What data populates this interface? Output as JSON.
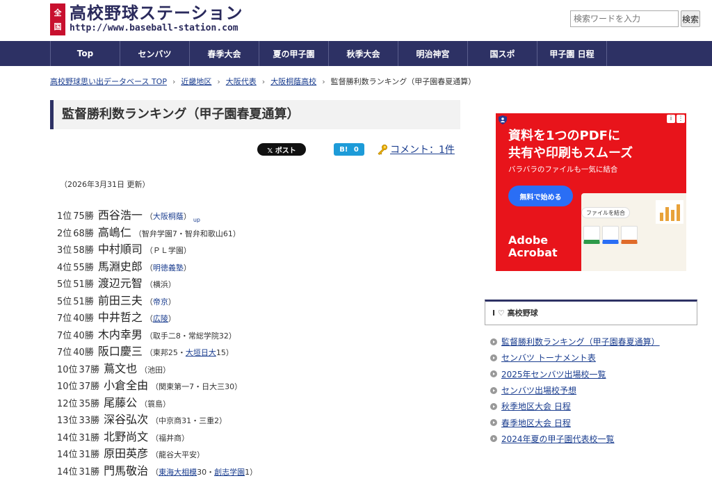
{
  "header": {
    "badge": [
      "全",
      "国"
    ],
    "site_title": "高校野球ステーション",
    "site_url": "http://www.baseball-station.com",
    "search_placeholder": "検索ワードを入力",
    "search_button": "検索"
  },
  "nav": {
    "items": [
      "Top",
      "センバツ",
      "春季大会",
      "夏の甲子園",
      "秋季大会",
      "明治神宮",
      "国スポ",
      "甲子園 日程"
    ]
  },
  "breadcrumb": [
    "高校野球思い出データベース TOP",
    "近畿地区",
    "大阪代表",
    "大阪桐蔭高校",
    "監督勝利数ランキング（甲子園春夏通算）"
  ],
  "main": {
    "title": "監督勝利数ランキング（甲子園春夏通算）",
    "share": {
      "x_label": "𝕏 ポスト",
      "hatena_label": "B!",
      "hatena_count": "0",
      "comment_label": "コメント：1件"
    },
    "updated": "（2026年3月31日 更新）",
    "ranking": [
      {
        "pos": "1位",
        "wins": "75勝",
        "name": "西谷浩一",
        "school": [
          {
            "t": "（"
          },
          {
            "t": "大阪桐蔭",
            "link": true
          },
          {
            "t": "）"
          }
        ],
        "up": "up"
      },
      {
        "pos": "2位",
        "wins": "68勝",
        "name": "高嶋仁",
        "school": [
          {
            "t": "（智弁学園7・智弁和歌山61）"
          }
        ]
      },
      {
        "pos": "3位",
        "wins": "58勝",
        "name": "中村順司",
        "school": [
          {
            "t": "（ＰＬ学園）"
          }
        ]
      },
      {
        "pos": "4位",
        "wins": "55勝",
        "name": "馬淵史郎",
        "school": [
          {
            "t": "（"
          },
          {
            "t": "明徳義塾",
            "link": true
          },
          {
            "t": "）"
          }
        ]
      },
      {
        "pos": "5位",
        "wins": "51勝",
        "name": "渡辺元智",
        "school": [
          {
            "t": "（横浜）"
          }
        ]
      },
      {
        "pos": "5位",
        "wins": "51勝",
        "name": "前田三夫",
        "school": [
          {
            "t": "（"
          },
          {
            "t": "帝京",
            "link": true
          },
          {
            "t": "）"
          }
        ]
      },
      {
        "pos": "7位",
        "wins": "40勝",
        "name": "中井哲之",
        "school": [
          {
            "t": "（"
          },
          {
            "t": "広陵",
            "link": true,
            "u": true
          },
          {
            "t": "）"
          }
        ]
      },
      {
        "pos": "7位",
        "wins": "40勝",
        "name": "木内幸男",
        "school": [
          {
            "t": "（取手二8・常総学院32）"
          }
        ]
      },
      {
        "pos": "7位",
        "wins": "40勝",
        "name": "阪口慶三",
        "school": [
          {
            "t": "（東邦25・"
          },
          {
            "t": "大垣日大",
            "link": true,
            "u": true
          },
          {
            "t": "15）"
          }
        ]
      },
      {
        "pos": "10位",
        "wins": "37勝",
        "name": "蔦文也",
        "school": [
          {
            "t": "（池田）"
          }
        ]
      },
      {
        "pos": "10位",
        "wins": "37勝",
        "name": "小倉全由",
        "school": [
          {
            "t": "（関東第一7・日大三30）"
          }
        ]
      },
      {
        "pos": "12位",
        "wins": "35勝",
        "name": "尾藤公",
        "school": [
          {
            "t": "（簑島）"
          }
        ]
      },
      {
        "pos": "13位",
        "wins": "33勝",
        "name": "深谷弘次",
        "school": [
          {
            "t": "（中京商31・三重2）"
          }
        ]
      },
      {
        "pos": "14位",
        "wins": "31勝",
        "name": "北野尚文",
        "school": [
          {
            "t": "（福井商）"
          }
        ]
      },
      {
        "pos": "14位",
        "wins": "31勝",
        "name": "原田英彦",
        "school": [
          {
            "t": "（龍谷大平安）"
          }
        ]
      },
      {
        "pos": "14位",
        "wins": "31勝",
        "name": "門馬敬治",
        "school": [
          {
            "t": "（"
          },
          {
            "t": "東海大相模",
            "link": true,
            "u": true
          },
          {
            "t": "30・"
          },
          {
            "t": "創志学園",
            "link": true,
            "u": true
          },
          {
            "t": "1）"
          }
        ]
      }
    ]
  },
  "ad": {
    "headline_1": "資料を1つのPDFに",
    "headline_2": "共有や印刷もスムーズ",
    "subtext": "バラバラのファイルも一気に結合",
    "cta": "無料で始める",
    "pill": "ファイルを結合",
    "brand_1": "Adobe",
    "brand_2": "Acrobat",
    "bg_color": "#e8141b",
    "cta_color": "#2a6ef5"
  },
  "sidebar": {
    "widget_title": "I ♡ 高校野球",
    "links": [
      "監督勝利数ランキング（甲子園春夏通算）",
      "センバツ トーナメント表",
      "2025年センバツ出場校一覧",
      "センバツ出場校予想",
      "秋季地区大会 日程",
      "春季地区大会 日程",
      "2024年夏の甲子園代表校一覧"
    ]
  },
  "colors": {
    "nav_bg": "#2d3164",
    "logo_badge": "#c8102e",
    "link": "#1a3d8f"
  }
}
